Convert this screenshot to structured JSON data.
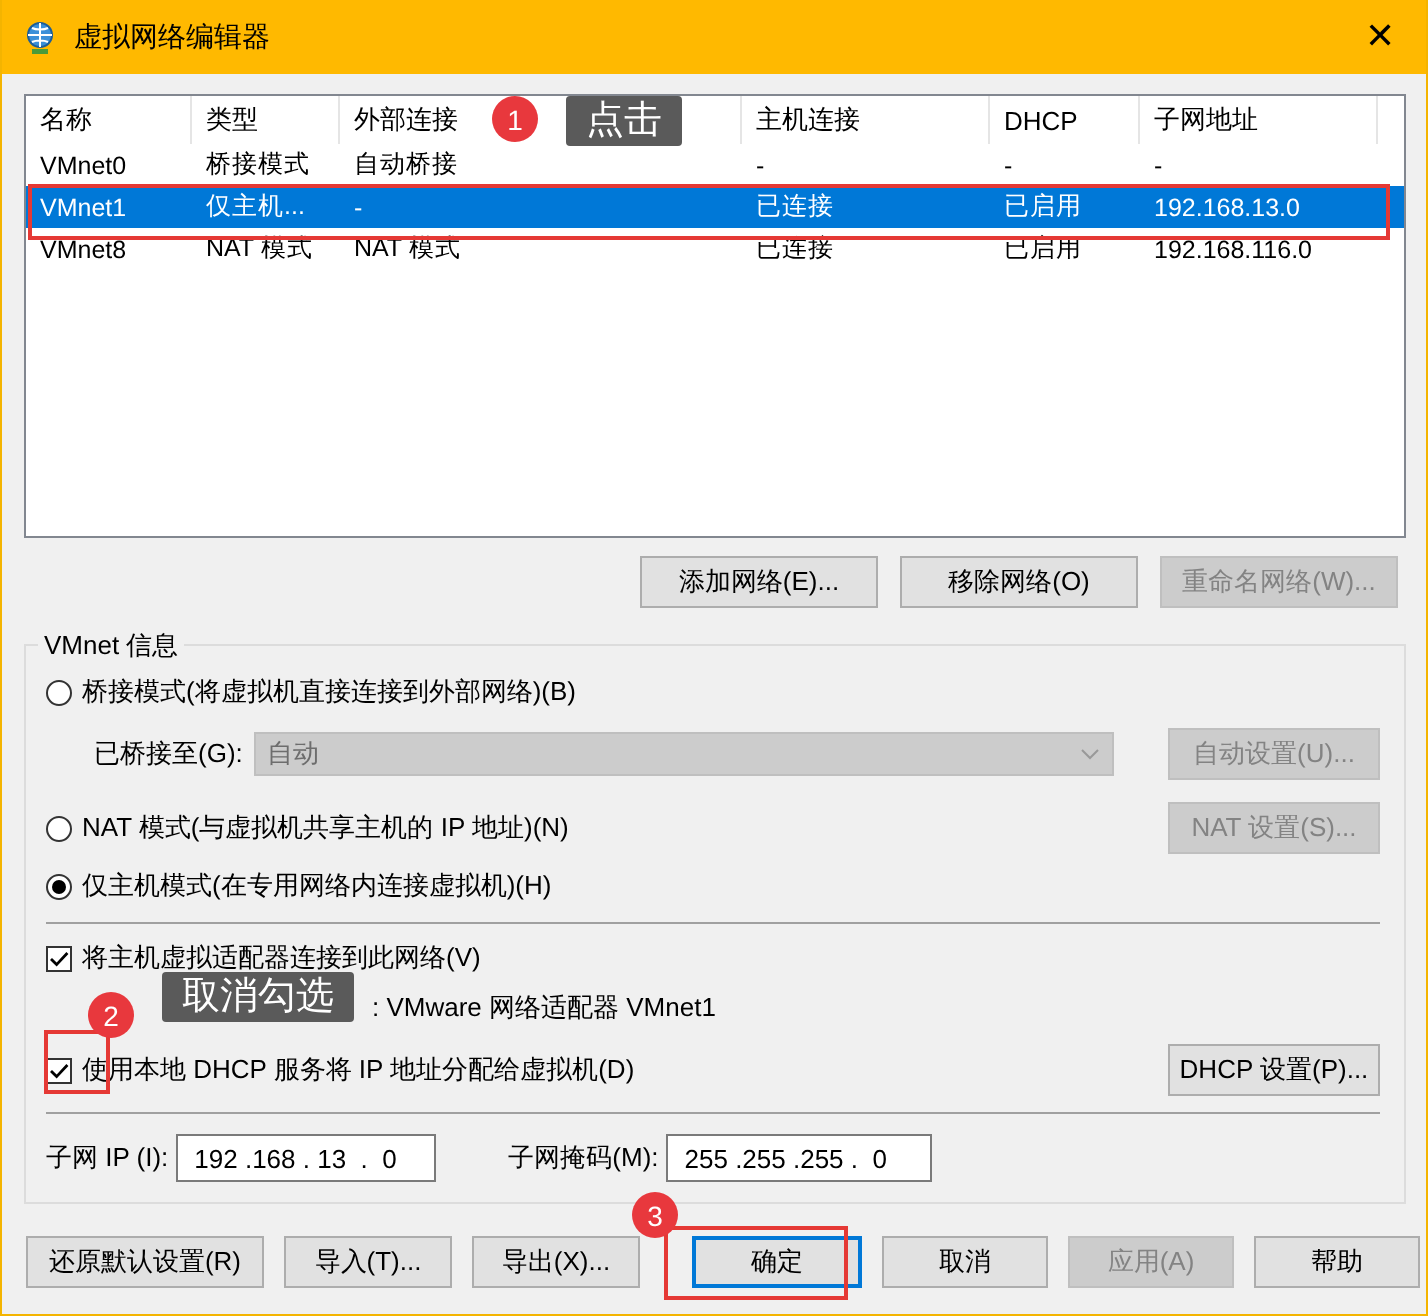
{
  "window": {
    "title": "虚拟网络编辑器",
    "close": "✕"
  },
  "table": {
    "columns": [
      "名称",
      "类型",
      "外部连接",
      "主机连接",
      "DHCP",
      "子网地址"
    ],
    "rows": [
      {
        "cells": [
          "VMnet0",
          "桥接模式",
          "自动桥接",
          "-",
          "-",
          "-"
        ],
        "selected": false
      },
      {
        "cells": [
          "VMnet1",
          "仅主机...",
          "-",
          "已连接",
          "已启用",
          "192.168.13.0"
        ],
        "selected": true
      },
      {
        "cells": [
          "VMnet8",
          "NAT 模式",
          "NAT 模式",
          "已连接",
          "已启用",
          "192.168.116.0"
        ],
        "selected": false
      }
    ]
  },
  "list_buttons": [
    {
      "label": "添加网络(E)...",
      "disabled": false
    },
    {
      "label": "移除网络(O)",
      "disabled": false
    },
    {
      "label": "重命名网络(W)...",
      "disabled": true
    }
  ],
  "vmnet_info": {
    "title": "VMnet 信息",
    "bridged": {
      "label": "桥接模式(将虚拟机直接连接到外部网络)(B)",
      "selected": false
    },
    "bridged_to": {
      "label": "已桥接至(G):",
      "value": "自动",
      "disabled": true,
      "button": {
        "label": "自动设置(U)...",
        "disabled": true
      }
    },
    "nat": {
      "label": "NAT 模式(与虚拟机共享主机的 IP 地址)(N)",
      "selected": false,
      "button": {
        "label": "NAT 设置(S)...",
        "disabled": true
      }
    },
    "host_only": {
      "label": "仅主机模式(在专用网络内连接虚拟机)(H)",
      "selected": true
    },
    "connect_adapter": {
      "label": "将主机虚拟适配器连接到此网络(V)",
      "checked": true
    },
    "adapter_name": ": VMware 网络适配器 VMnet1",
    "use_dhcp": {
      "label": "使用本地 DHCP 服务将 IP 地址分配给虚拟机(D)",
      "checked": true,
      "button": {
        "label": "DHCP 设置(P)...",
        "disabled": false
      }
    },
    "subnet_ip": {
      "label": "子网 IP (I):",
      "value": "192 .168 . 13  .  0"
    },
    "subnet_mask": {
      "label": "子网掩码(M):",
      "value": "255 .255 .255 .  0"
    }
  },
  "footer_buttons": [
    {
      "label": "还原默认设置(R)",
      "disabled": false
    },
    {
      "label": "导入(T)...",
      "disabled": false
    },
    {
      "label": "导出(X)...",
      "disabled": false
    },
    {
      "label": "确定",
      "disabled": false
    },
    {
      "label": "取消",
      "disabled": false
    },
    {
      "label": "应用(A)",
      "disabled": true
    },
    {
      "label": "帮助",
      "disabled": false
    }
  ],
  "annotations": [
    {
      "number": "1",
      "text": "点击"
    },
    {
      "number": "2",
      "text": "取消勾选"
    },
    {
      "number": "3"
    }
  ]
}
